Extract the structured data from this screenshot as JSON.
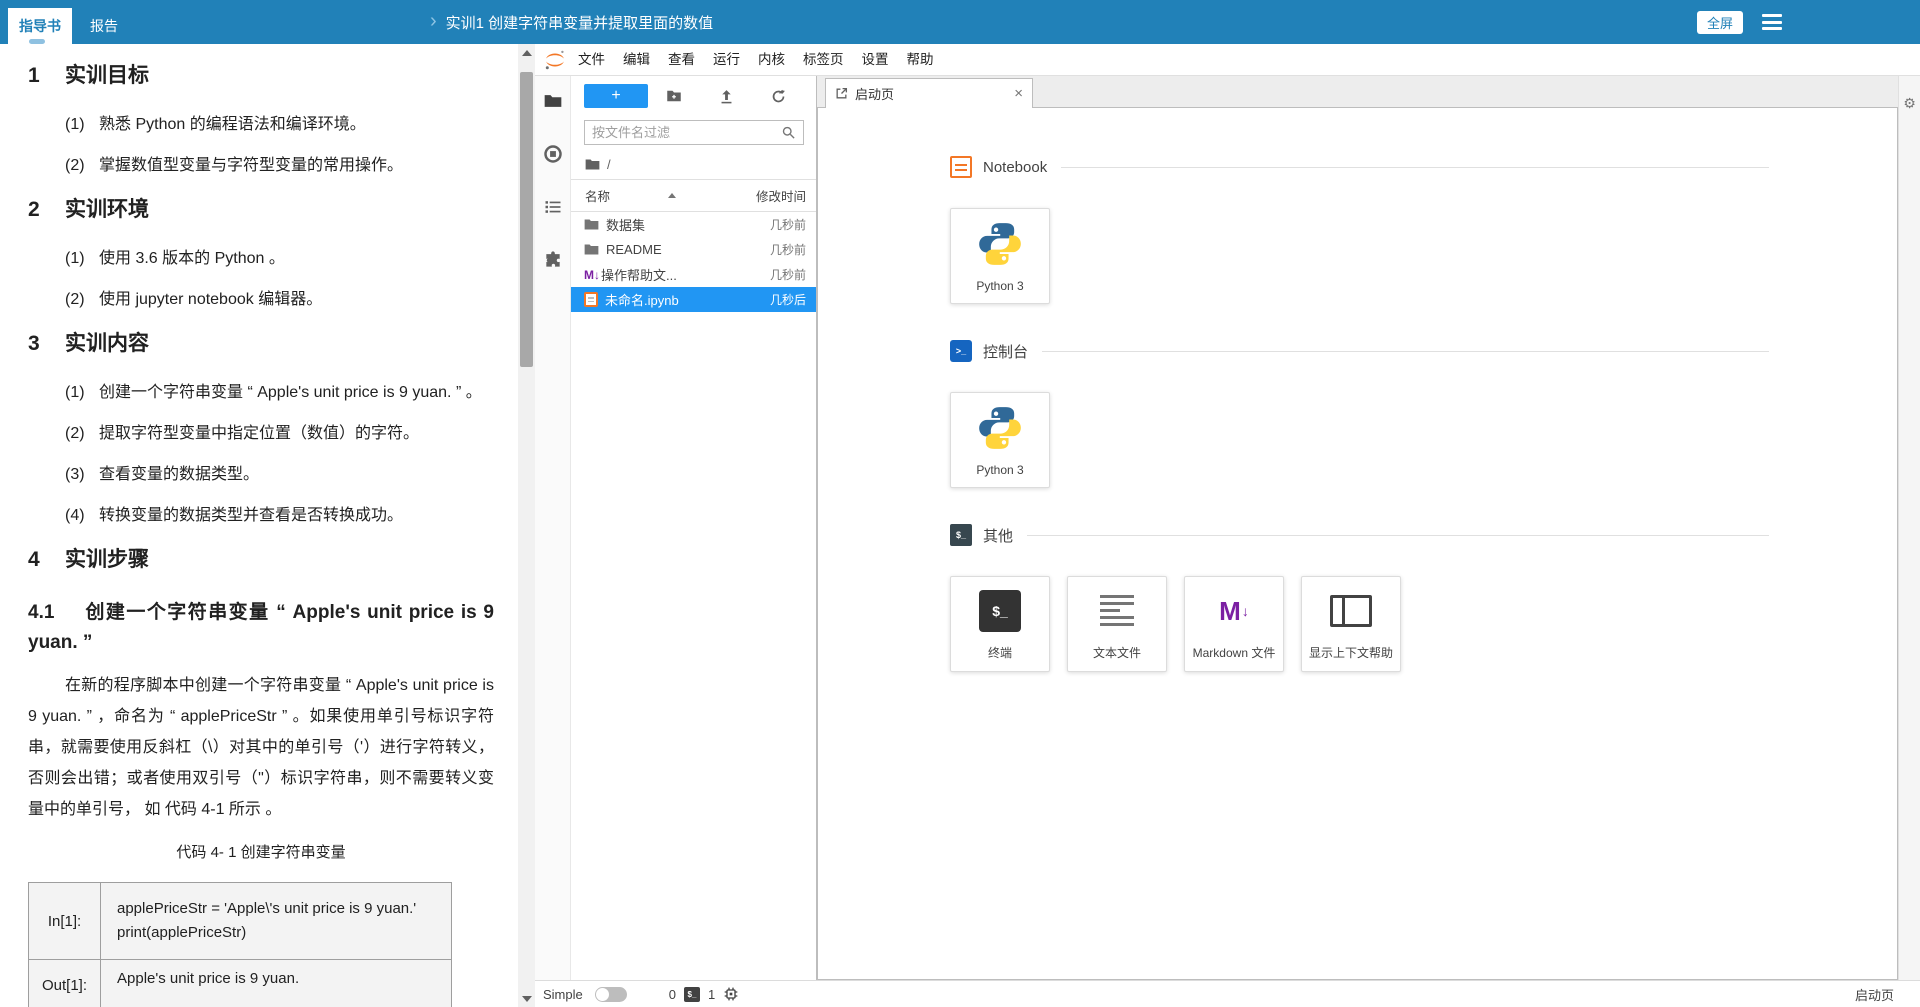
{
  "colors": {
    "accent": "#2181b8",
    "selection": "#2196f3",
    "jupyter-orange": "#f37726",
    "md-purple": "#7b1fa2",
    "python-blue": "#306998",
    "python-yellow": "#ffd43b"
  },
  "header": {
    "tab_guide": "指导书",
    "tab_report": "报告",
    "breadcrumb_title": "实训1 创建字符串变量并提取里面的数值",
    "fullscreen_label": "全屏"
  },
  "document": {
    "h1": {
      "num": "1",
      "title": "实训目标"
    },
    "s1": [
      {
        "label": "(1)",
        "text": "熟悉 Python 的编程语法和编译环境。"
      },
      {
        "label": "(2)",
        "text": "掌握数值型变量与字符型变量的常用操作。"
      }
    ],
    "h2": {
      "num": "2",
      "title": "实训环境"
    },
    "s2": [
      {
        "label": "(1)",
        "text": "使用 3.6 版本的 Python 。"
      },
      {
        "label": "(2)",
        "text": "使用 jupyter notebook 编辑器。"
      }
    ],
    "h3": {
      "num": "3",
      "title": "实训内容"
    },
    "s3": [
      {
        "label": "(1)",
        "text": "创建一个字符串变量 “ Apple's unit price is 9 yuan. ” 。"
      },
      {
        "label": "(2)",
        "text": "提取字符型变量中指定位置（数值）的字符。"
      },
      {
        "label": "(3)",
        "text": "查看变量的数据类型。"
      },
      {
        "label": "(4)",
        "text": "转换变量的数据类型并查看是否转换成功。"
      }
    ],
    "h4": {
      "num": "4",
      "title": "实训步骤"
    },
    "h41": {
      "num": "4.1",
      "title": "创建一个字符串变量 “ Apple's unit price is 9 yuan. ”"
    },
    "para": "在新的程序脚本中创建一个字符串变量 “ Apple's unit price is 9 yuan. ” ，命名为 “ applePriceStr ” 。如果使用单引号标识字符串，就需要使用反斜杠（\\）对其中的单引号（'）进行字符转义，否则会出错；或者使用双引号（\"）标识字符串，则不需要转义变量中的单引号， 如 代码 4-1 所示 。",
    "code_caption": "代码 4- 1 创建字符串变量",
    "table": {
      "in_label": "In[1]:",
      "in_line1": "applePriceStr = 'Apple\\'s unit price is 9 yuan.'",
      "in_line2": "print(applePriceStr)",
      "out_label": "Out[1]:",
      "out_line": "Apple's unit price is 9 yuan."
    }
  },
  "jupyter": {
    "menu": [
      "文件",
      "编辑",
      "查看",
      "运行",
      "内核",
      "标签页",
      "设置",
      "帮助"
    ],
    "filebrowser": {
      "filter_placeholder": "按文件名过滤",
      "breadcrumb_root": "/",
      "col_name": "名称",
      "col_modified": "修改时间",
      "files": [
        {
          "name": "数据集",
          "time": "几秒前"
        },
        {
          "name": "README",
          "time": "几秒前"
        },
        {
          "name": "操作帮助文...",
          "time": "几秒前"
        },
        {
          "name": "未命名.ipynb",
          "time": "几秒后"
        }
      ]
    },
    "tab_title": "启动页",
    "launcher": {
      "sections": [
        {
          "label": "Notebook",
          "cards": [
            {
              "label": "Python 3"
            }
          ]
        },
        {
          "label": "控制台",
          "cards": [
            {
              "label": "Python 3"
            }
          ]
        },
        {
          "label": "其他",
          "cards": [
            {
              "label": "终端"
            },
            {
              "label": "文本文件"
            },
            {
              "label": "Markdown 文件"
            },
            {
              "label": "显示上下文帮助"
            }
          ]
        }
      ]
    },
    "statusbar": {
      "simple_label": "Simple",
      "terminal_count": "0",
      "kernel_count": "1",
      "right_label": "启动页"
    }
  }
}
